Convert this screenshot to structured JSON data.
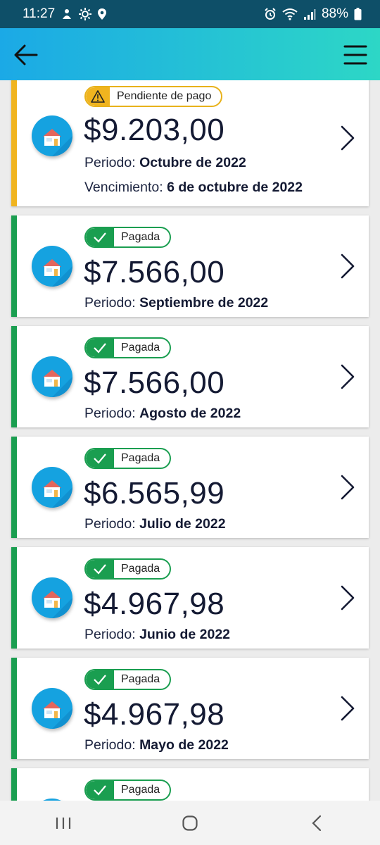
{
  "status_bar": {
    "time": "11:27",
    "battery": "88%",
    "icons_left": [
      "notification-icon",
      "brightness-icon",
      "location-icon"
    ],
    "icons_right": [
      "alarm-icon",
      "wifi-icon",
      "signal-icon",
      "battery-icon"
    ]
  },
  "app_bar": {
    "back_icon": "arrow-left-icon",
    "menu_icon": "hamburger-menu-icon"
  },
  "labels": {
    "period": "Periodo: ",
    "due": "Vencimiento: "
  },
  "colors": {
    "paid": "#1a9e50",
    "pending": "#f0b41f",
    "house_circle": "#15a2e0",
    "header_gradient_start": "#1ba9e6",
    "header_gradient_end": "#2dd7c6"
  },
  "invoices": [
    {
      "status": "Pendiente de pago",
      "amount": "$9.203,00",
      "period": "Octubre de 2022",
      "due": "6 de octubre de 2022"
    },
    {
      "status": "Pagada",
      "amount": "$7.566,00",
      "period": "Septiembre de 2022"
    },
    {
      "status": "Pagada",
      "amount": "$7.566,00",
      "period": "Agosto de 2022"
    },
    {
      "status": "Pagada",
      "amount": "$6.565,99",
      "period": "Julio de 2022"
    },
    {
      "status": "Pagada",
      "amount": "$4.967,98",
      "period": "Junio de 2022"
    },
    {
      "status": "Pagada",
      "amount": "$4.967,98",
      "period": "Mayo de 2022"
    },
    {
      "status": "Pagada"
    }
  ],
  "nav_bar": {
    "icons": [
      "recent-apps-icon",
      "home-icon",
      "back-icon"
    ]
  }
}
